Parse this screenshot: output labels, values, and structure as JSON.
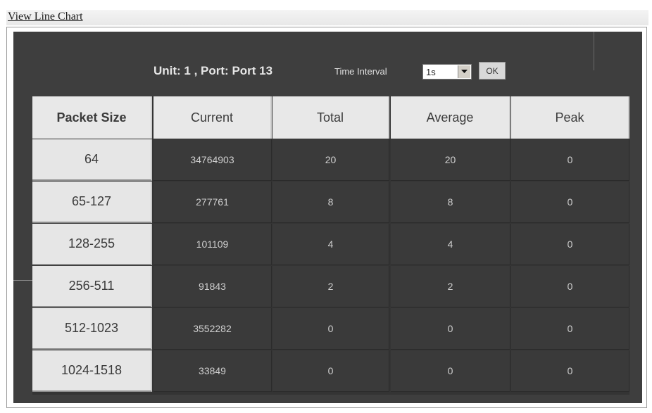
{
  "link": {
    "label": "View Line Chart"
  },
  "header": {
    "title": "Unit: 1 , Port: Port 13",
    "interval_label": "Time Interval",
    "interval_value": "1s",
    "ok_label": "OK"
  },
  "table": {
    "columns": [
      "Packet Size",
      "Current",
      "Total",
      "Average",
      "Peak"
    ],
    "rows": [
      {
        "size": "64",
        "current": "34764903",
        "total": "20",
        "average": "20",
        "peak": "0"
      },
      {
        "size": "65-127",
        "current": "277761",
        "total": "8",
        "average": "8",
        "peak": "0"
      },
      {
        "size": "128-255",
        "current": "101109",
        "total": "4",
        "average": "4",
        "peak": "0"
      },
      {
        "size": "256-511",
        "current": "91843",
        "total": "2",
        "average": "2",
        "peak": "0"
      },
      {
        "size": "512-1023",
        "current": "3552282",
        "total": "0",
        "average": "0",
        "peak": "0"
      },
      {
        "size": "1024-1518",
        "current": "33849",
        "total": "0",
        "average": "0",
        "peak": "0"
      }
    ]
  }
}
